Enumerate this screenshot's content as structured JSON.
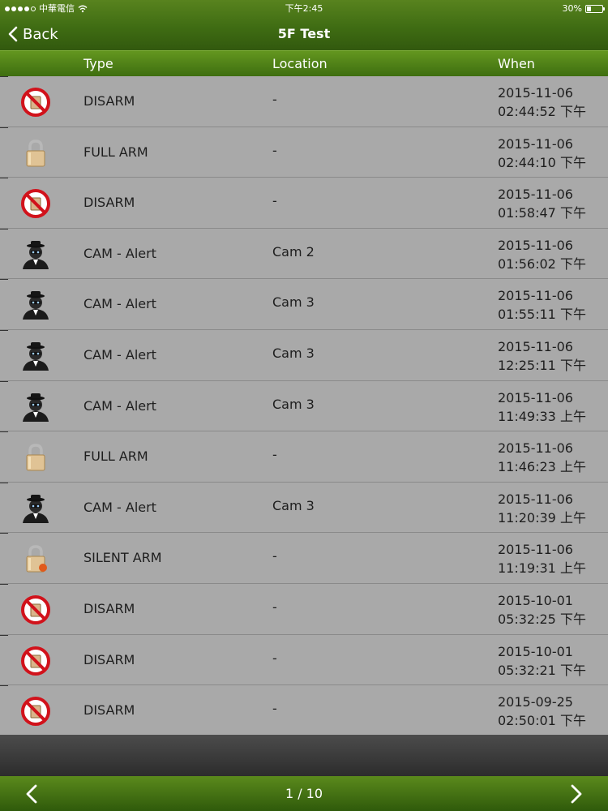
{
  "status_bar": {
    "carrier": "中華電信",
    "time": "下午2:45",
    "battery_text": "30%",
    "battery_level": 0.3
  },
  "nav": {
    "back_label": "Back",
    "title": "5F Test"
  },
  "columns": {
    "type": "Type",
    "location": "Location",
    "when": "When"
  },
  "events": [
    {
      "icon": "disarm-icon",
      "type": "DISARM",
      "location": "-",
      "date": "2015-11-06",
      "time": "02:44:52 下午"
    },
    {
      "icon": "full-arm-lock-icon",
      "type": "FULL ARM",
      "location": "-",
      "date": "2015-11-06",
      "time": "02:44:10 下午"
    },
    {
      "icon": "disarm-icon",
      "type": "DISARM",
      "location": "-",
      "date": "2015-11-06",
      "time": "01:58:47 下午"
    },
    {
      "icon": "intruder-icon",
      "type": "CAM - Alert",
      "location": "Cam 2",
      "date": "2015-11-06",
      "time": "01:56:02 下午"
    },
    {
      "icon": "intruder-icon",
      "type": "CAM - Alert",
      "location": "Cam 3",
      "date": "2015-11-06",
      "time": "01:55:11 下午"
    },
    {
      "icon": "intruder-icon",
      "type": "CAM - Alert",
      "location": "Cam 3",
      "date": "2015-11-06",
      "time": "12:25:11 下午"
    },
    {
      "icon": "intruder-icon",
      "type": "CAM - Alert",
      "location": "Cam 3",
      "date": "2015-11-06",
      "time": "11:49:33 上午"
    },
    {
      "icon": "full-arm-lock-icon",
      "type": "FULL ARM",
      "location": "-",
      "date": "2015-11-06",
      "time": "11:46:23 上午"
    },
    {
      "icon": "intruder-icon",
      "type": "CAM - Alert",
      "location": "Cam 3",
      "date": "2015-11-06",
      "time": "11:20:39 上午"
    },
    {
      "icon": "silent-arm-lock-icon",
      "type": "SILENT ARM",
      "location": "-",
      "date": "2015-11-06",
      "time": "11:19:31 上午"
    },
    {
      "icon": "disarm-icon",
      "type": "DISARM",
      "location": "-",
      "date": "2015-10-01",
      "time": "05:32:25 下午"
    },
    {
      "icon": "disarm-icon",
      "type": "DISARM",
      "location": "-",
      "date": "2015-10-01",
      "time": "05:32:21 下午"
    },
    {
      "icon": "disarm-icon",
      "type": "DISARM",
      "location": "-",
      "date": "2015-09-25",
      "time": "02:50:01 下午"
    }
  ],
  "pager": {
    "label": "1 / 10"
  },
  "colors": {
    "header_green": "#3f6c13",
    "row_gray": "#a9a9a9",
    "disarm_red": "#d1121b"
  }
}
